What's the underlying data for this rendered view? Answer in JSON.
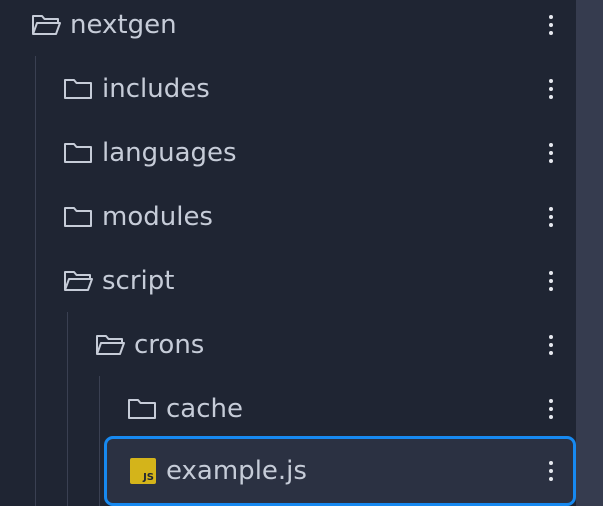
{
  "tree": {
    "items": [
      {
        "label": "nextgen",
        "type": "folder-open"
      },
      {
        "label": "includes",
        "type": "folder"
      },
      {
        "label": "languages",
        "type": "folder"
      },
      {
        "label": "modules",
        "type": "folder"
      },
      {
        "label": "script",
        "type": "folder-open"
      },
      {
        "label": "crons",
        "type": "folder-open"
      },
      {
        "label": "cache",
        "type": "folder"
      },
      {
        "label": "example.js",
        "type": "file-js",
        "badge": "JS",
        "selected": true
      }
    ]
  },
  "colors": {
    "background": "#1f2533",
    "text": "#c6ccd8",
    "selection_border": "#1789f0",
    "js_badge": "#d4b41a",
    "scrollbar": "#363c4f"
  }
}
